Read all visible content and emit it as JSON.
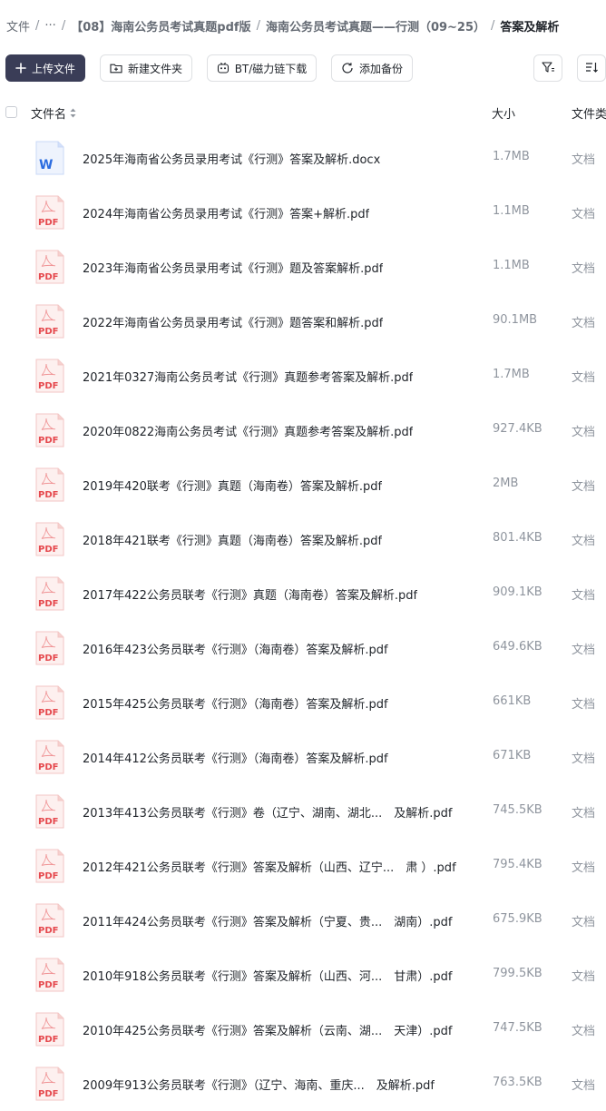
{
  "breadcrumb": {
    "items": [
      "文件",
      "···",
      "【08】海南公务员考试真题pdf版",
      "海南公务员考试真题——行测（09~25）"
    ],
    "current": "答案及解析",
    "separator": "/"
  },
  "toolbar": {
    "upload_label": "上传文件",
    "new_folder_label": "新建文件夹",
    "bt_label": "BT/磁力链下载",
    "backup_label": "添加备份"
  },
  "table": {
    "col_name": "文件名",
    "col_size": "大小",
    "col_type": "文件类"
  },
  "files": [
    {
      "name": "2025年海南省公务员录用考试《行测》答案及解析.docx",
      "size": "1.7MB",
      "type": "文档",
      "icon": "word-icon"
    },
    {
      "name": "2024年海南省公务员录用考试《行测》答案+解析.pdf",
      "size": "1.1MB",
      "type": "文档",
      "icon": "pdf-icon"
    },
    {
      "name": "2023年海南省公务员录用考试《行测》题及答案解析.pdf",
      "size": "1.1MB",
      "type": "文档",
      "icon": "pdf-icon"
    },
    {
      "name": "2022年海南省公务员录用考试《行测》题答案和解析.pdf",
      "size": "90.1MB",
      "type": "文档",
      "icon": "pdf-icon"
    },
    {
      "name": "2021年0327海南公务员考试《行测》真题参考答案及解析.pdf",
      "size": "1.7MB",
      "type": "文档",
      "icon": "pdf-icon"
    },
    {
      "name": "2020年0822海南公务员考试《行测》真题参考答案及解析.pdf",
      "size": "927.4KB",
      "type": "文档",
      "icon": "pdf-icon"
    },
    {
      "name": "2019年420联考《行测》真题（海南卷）答案及解析.pdf",
      "size": "2MB",
      "type": "文档",
      "icon": "pdf-icon"
    },
    {
      "name": "2018年421联考《行测》真题（海南卷）答案及解析.pdf",
      "size": "801.4KB",
      "type": "文档",
      "icon": "pdf-icon"
    },
    {
      "name": "2017年422公务员联考《行测》真题（海南卷）答案及解析.pdf",
      "size": "909.1KB",
      "type": "文档",
      "icon": "pdf-icon"
    },
    {
      "name": "2016年423公务员联考《行测》（海南卷）答案及解析.pdf",
      "size": "649.6KB",
      "type": "文档",
      "icon": "pdf-icon"
    },
    {
      "name": "2015年425公务员联考《行测》（海南卷）答案及解析.pdf",
      "size": "661KB",
      "type": "文档",
      "icon": "pdf-icon"
    },
    {
      "name": "2014年412公务员联考《行测》（海南卷）答案及解析.pdf",
      "size": "671KB",
      "type": "文档",
      "icon": "pdf-icon"
    },
    {
      "name": "2013年413公务员联考《行测》卷（辽宁、湖南、湖北...　及解析.pdf",
      "size": "745.5KB",
      "type": "文档",
      "icon": "pdf-icon"
    },
    {
      "name": "2012年421公务员联考《行测》答案及解析（山西、辽宁...　肃 ）.pdf",
      "size": "795.4KB",
      "type": "文档",
      "icon": "pdf-icon"
    },
    {
      "name": "2011年424公务员联考《行测》答案及解析（宁夏、贵...　湖南）.pdf",
      "size": "675.9KB",
      "type": "文档",
      "icon": "pdf-icon"
    },
    {
      "name": "2010年918公务员联考《行测》答案及解析（山西、河...　甘肃）.pdf",
      "size": "799.5KB",
      "type": "文档",
      "icon": "pdf-icon"
    },
    {
      "name": "2010年425公务员联考《行测》答案及解析（云南、湖...　天津）.pdf",
      "size": "747.5KB",
      "type": "文档",
      "icon": "pdf-icon"
    },
    {
      "name": "2009年913公务员联考《行测》（辽宁、海南、重庆...　及解析.pdf",
      "size": "763.5KB",
      "type": "文档",
      "icon": "pdf-icon"
    }
  ],
  "colors": {
    "primary_button": "#3a3d57",
    "pdf_red": "#e5484d",
    "word_blue": "#2b6ce0",
    "muted_text": "#8f959e"
  }
}
